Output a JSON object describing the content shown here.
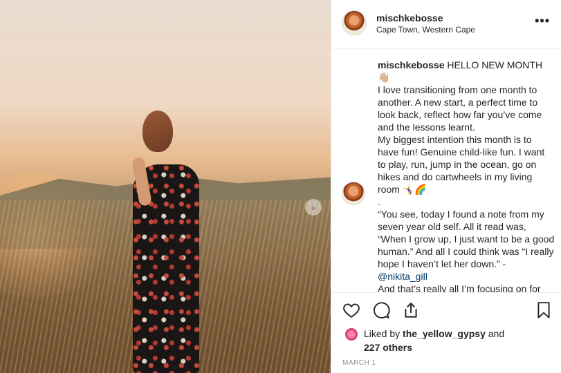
{
  "post": {
    "author": "mischkebosse",
    "location": "Cape Town, Western Cape",
    "more_label": "•••",
    "next_label": "›"
  },
  "caption": {
    "author": "mischkebosse",
    "text": " HELLO NEW MONTH 👋🏼\nI love transitioning from one month to another. A new start, a perfect time to look back, reflect how far you’ve come and the lessons learnt.\nMy biggest intention this month is to have fun! Genuine child-like fun. I want to play, run, jump in the ocean, go on hikes and do cartwheels in my living room 🤸‍♀️🌈\n.\n“You see, today I found a note from my seven year old self. All it read was, “When I grow up, I just want to be a good human.” And all I could think was “I really hope I haven’t let her down.” - ",
    "mention": "@nikita_gill",
    "text_after": "\nAnd that’s really all I’m focusing on for"
  },
  "likes": {
    "prefix": "Liked by ",
    "user": "the_yellow_gypsy",
    "suffix": " and",
    "others": "227 others"
  },
  "date": "MARCH 1",
  "icons": [
    "heart-icon",
    "comment-icon",
    "share-icon",
    "bookmark-icon"
  ],
  "colors": {
    "link": "#00376b",
    "text": "#262626",
    "muted": "#8e8e8e"
  }
}
